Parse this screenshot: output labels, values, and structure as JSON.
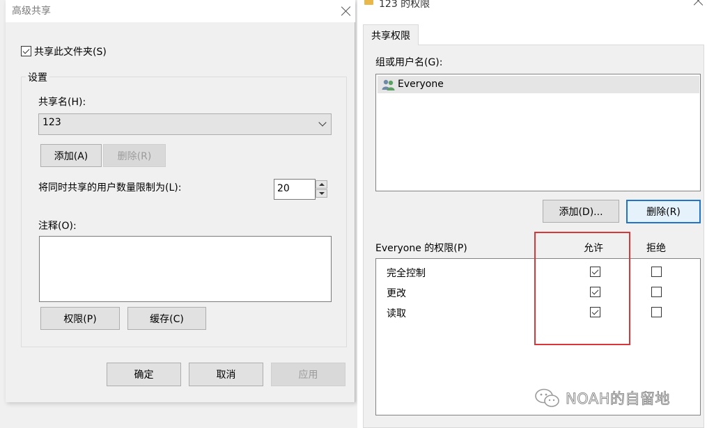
{
  "left_dialog": {
    "title": "高级共享",
    "share_checkbox": {
      "label": "共享此文件夹(S)",
      "checked": true
    },
    "settings_group_label": "设置",
    "share_name_label": "共享名(H):",
    "share_name_value": "123",
    "add_button": "添加(A)",
    "remove_button": "删除(R)",
    "user_limit_label": "将同时共享的用户数量限制为(L):",
    "user_limit_value": "20",
    "comment_label": "注释(O):",
    "permissions_button": "权限(P)",
    "cache_button": "缓存(C)",
    "ok_button": "确定",
    "cancel_button": "取消",
    "apply_button": "应用"
  },
  "right_dialog": {
    "title": "123 的权限",
    "tab_label": "共享权限",
    "group_label": "组或用户名(G):",
    "users": [
      {
        "name": "Everyone"
      }
    ],
    "add_button": "添加(D)...",
    "remove_button": "删除(R)",
    "permissions_label": "Everyone 的权限(P)",
    "allow_header": "允许",
    "deny_header": "拒绝",
    "permissions": [
      {
        "name": "完全控制",
        "allow": true,
        "deny": false
      },
      {
        "name": "更改",
        "allow": true,
        "deny": false
      },
      {
        "name": "读取",
        "allow": true,
        "deny": false
      }
    ]
  },
  "watermark": {
    "text": "NOAH的自留地",
    "icon": "wechat-icon"
  },
  "colors": {
    "highlight": "#d9363a",
    "focus": "#1f73c8"
  }
}
